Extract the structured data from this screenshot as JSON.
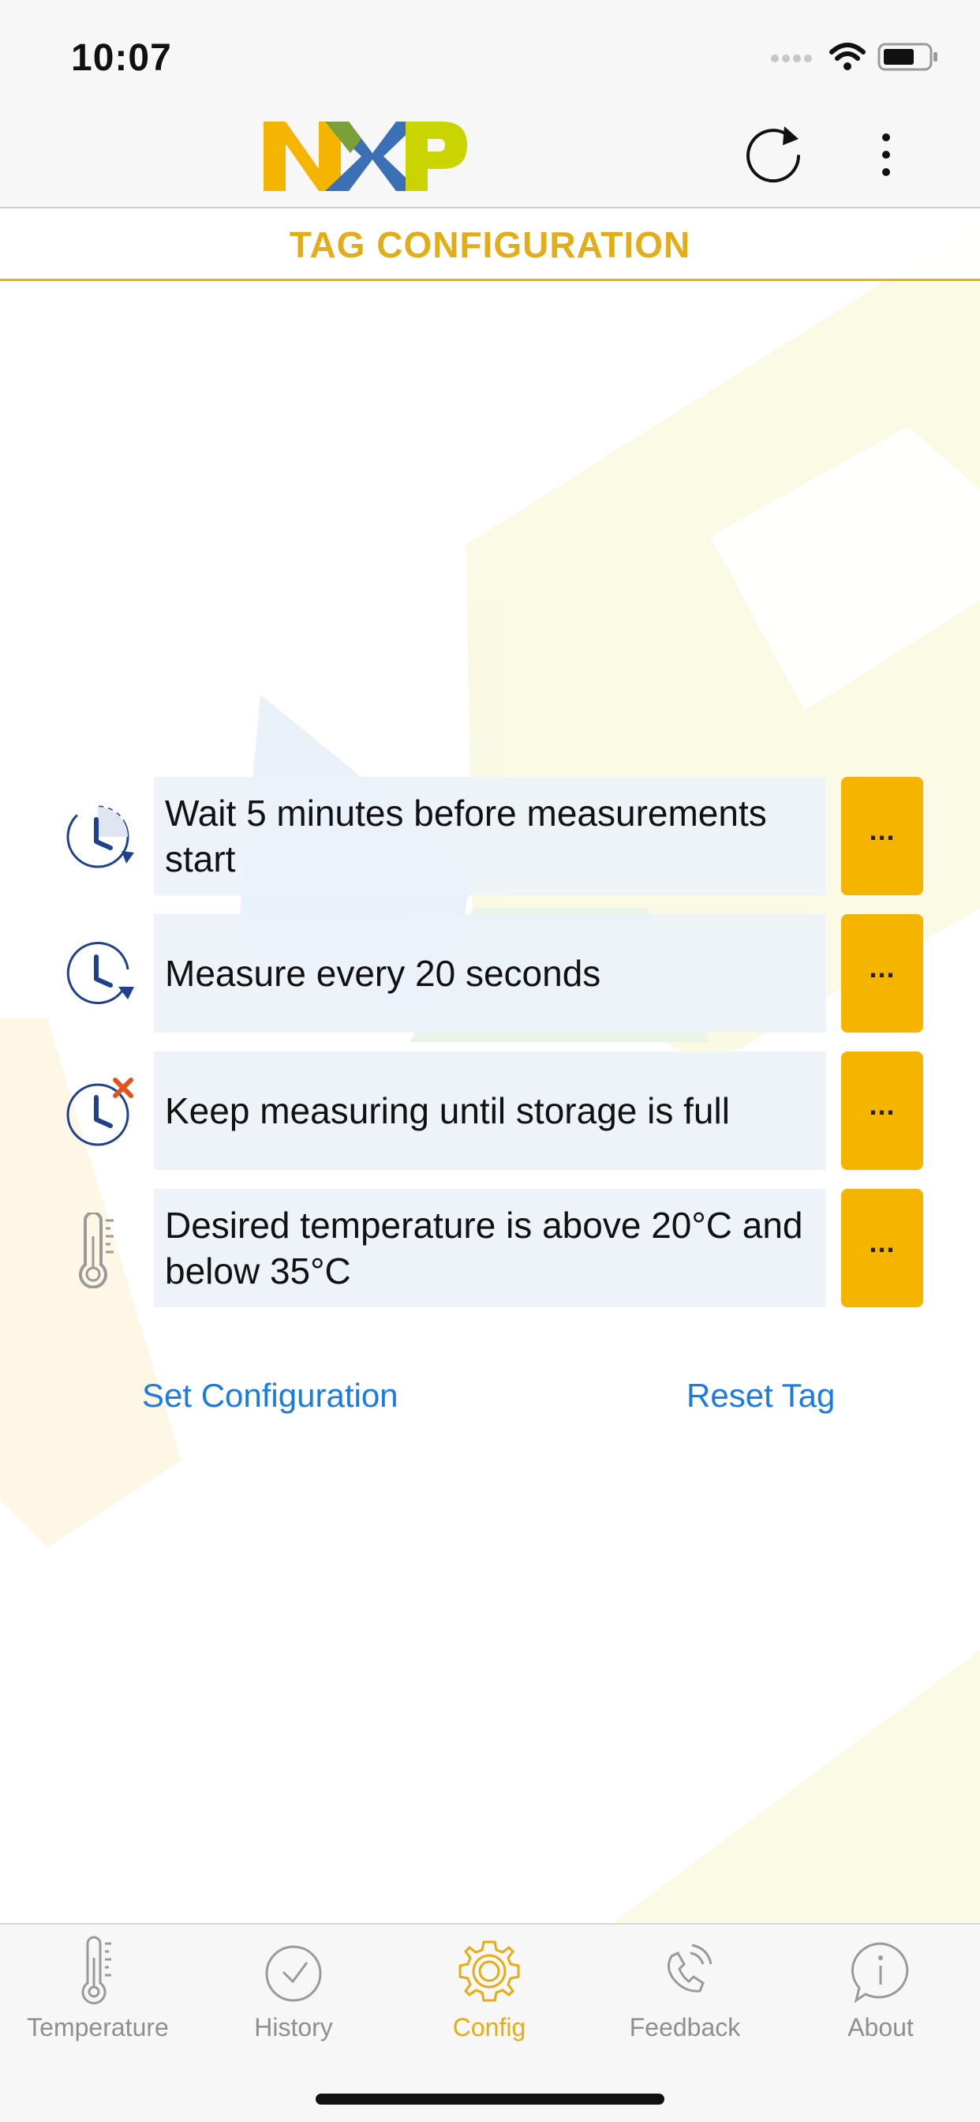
{
  "status": {
    "time": "10:07"
  },
  "header": {
    "logo_text": "NXP",
    "refresh_icon": "refresh-icon",
    "more_icon": "more-vertical-icon"
  },
  "page": {
    "title": "TAG CONFIGURATION"
  },
  "config": {
    "rows": [
      {
        "icon": "delayed-start-clock-icon",
        "text": "Wait 5 minutes before measurements start",
        "button_label": "..."
      },
      {
        "icon": "interval-clock-icon",
        "text": "Measure every 20 seconds",
        "button_label": "..."
      },
      {
        "icon": "stop-clock-icon",
        "text": "Keep measuring until storage is full",
        "button_label": "..."
      },
      {
        "icon": "thermometer-icon",
        "text": "Desired temperature is above 20°C and below 35°C",
        "button_label": "..."
      }
    ]
  },
  "actions": {
    "set_configuration": "Set Configuration",
    "reset_tag": "Reset Tag"
  },
  "tabs": [
    {
      "label": "Temperature",
      "icon": "thermometer-icon",
      "active": false
    },
    {
      "label": "History",
      "icon": "clock-icon",
      "active": false
    },
    {
      "label": "Config",
      "icon": "gear-icon",
      "active": true
    },
    {
      "label": "Feedback",
      "icon": "phone-icon",
      "active": false
    },
    {
      "label": "About",
      "icon": "info-bubble-icon",
      "active": false
    }
  ],
  "colors": {
    "accent": "#e8ab10",
    "button": "#f5b400",
    "link": "#1a7be0",
    "icon_blue": "#1f3f8f",
    "stop_red": "#e0541b"
  }
}
